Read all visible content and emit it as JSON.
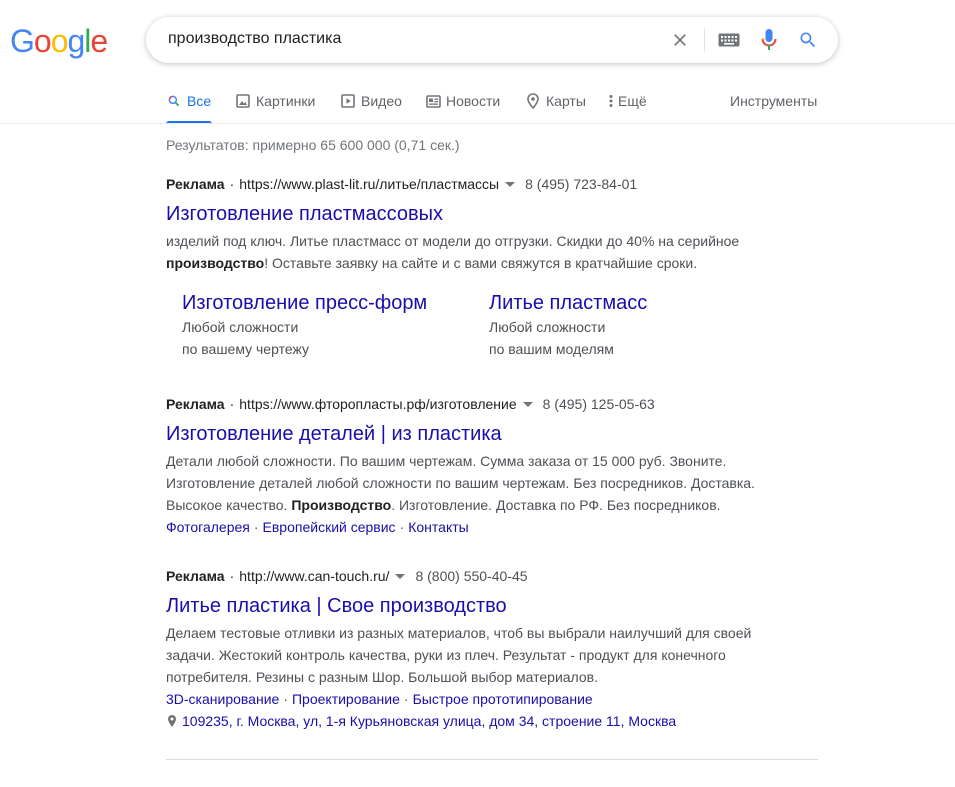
{
  "logo": {
    "letters": [
      "G",
      "o",
      "o",
      "g",
      "l",
      "e"
    ],
    "colors": [
      "#4285f4",
      "#ea4335",
      "#fbbc05",
      "#4285f4",
      "#34a853",
      "#ea4335"
    ]
  },
  "search": {
    "query": "производство пластика",
    "icons": {
      "clear": "close-icon",
      "keyboard": "keyboard-icon",
      "voice": "mic-icon",
      "search": "search-icon"
    }
  },
  "tabs": [
    {
      "label": "Все",
      "icon": "search-icon",
      "active": true
    },
    {
      "label": "Картинки",
      "icon": "image-icon",
      "active": false
    },
    {
      "label": "Видео",
      "icon": "video-icon",
      "active": false
    },
    {
      "label": "Новости",
      "icon": "news-icon",
      "active": false
    },
    {
      "label": "Карты",
      "icon": "map-pin-icon",
      "active": false
    },
    {
      "label": "Ещё",
      "icon": "more-vert-icon",
      "active": false
    }
  ],
  "tools_label": "Инструменты",
  "result_stats": "Результатов: примерно 65 600 000 (0,71 сек.)",
  "ads": [
    {
      "label": "Реклама",
      "url": "https://www.plast-lit.ru/литье/пластмассы",
      "phone": "8 (495) 723-84-01",
      "title": "Изготовление пластмассовых",
      "desc_1": "изделий под ключ. Литье пластмасс от модели до отгрузки. Скидки до 40% на серийное",
      "desc_bold": "производство",
      "desc_2": "! Оставьте заявку на сайте и с вами свяжутся в кратчайшие сроки.",
      "sitelinks": [
        {
          "title": "Изготовление пресс-форм",
          "line1": "Любой сложности",
          "line2": "по вашему чертежу"
        },
        {
          "title": "Литье пластмасс",
          "line1": "Любой сложности",
          "line2": "по вашим моделям"
        }
      ]
    },
    {
      "label": "Реклама",
      "url": "https://www.фторопласты.рф/изготовление",
      "phone": "8 (495) 125-05-63",
      "title": "Изготовление деталей | из пластика",
      "desc_1": "Детали любой сложности. По вашим чертежам. Сумма заказа от 15 000 руб. Звоните. Изготовление деталей любой сложности по вашим чертежам. Без посредников. Доставка. Высокое качество. ",
      "desc_bold": "Производство",
      "desc_2": ". Изготовление. Доставка по РФ. Без посредников.",
      "links": [
        "Фотогалерея",
        "Европейский сервис",
        "Контакты"
      ]
    },
    {
      "label": "Реклама",
      "url": "http://www.can-touch.ru/",
      "phone": "8 (800) 550-40-45",
      "title": "Литье пластика | Свое производство",
      "desc_1": "Делаем тестовые отливки из разных материалов, чтоб вы выбрали наилучший для своей задачи. Жестокий контроль качества, руки из плеч. Результат - продукт для конечного потребителя. Резины с разным Шор. Большой выбор материалов.",
      "links": [
        "3D-сканирование",
        "Проектирование",
        "Быстрое прототипирование"
      ],
      "address": "109235, г. Москва, ул, 1-я Курьяновская улица, дом 34, строение 11, Москва"
    }
  ],
  "separator": "·"
}
